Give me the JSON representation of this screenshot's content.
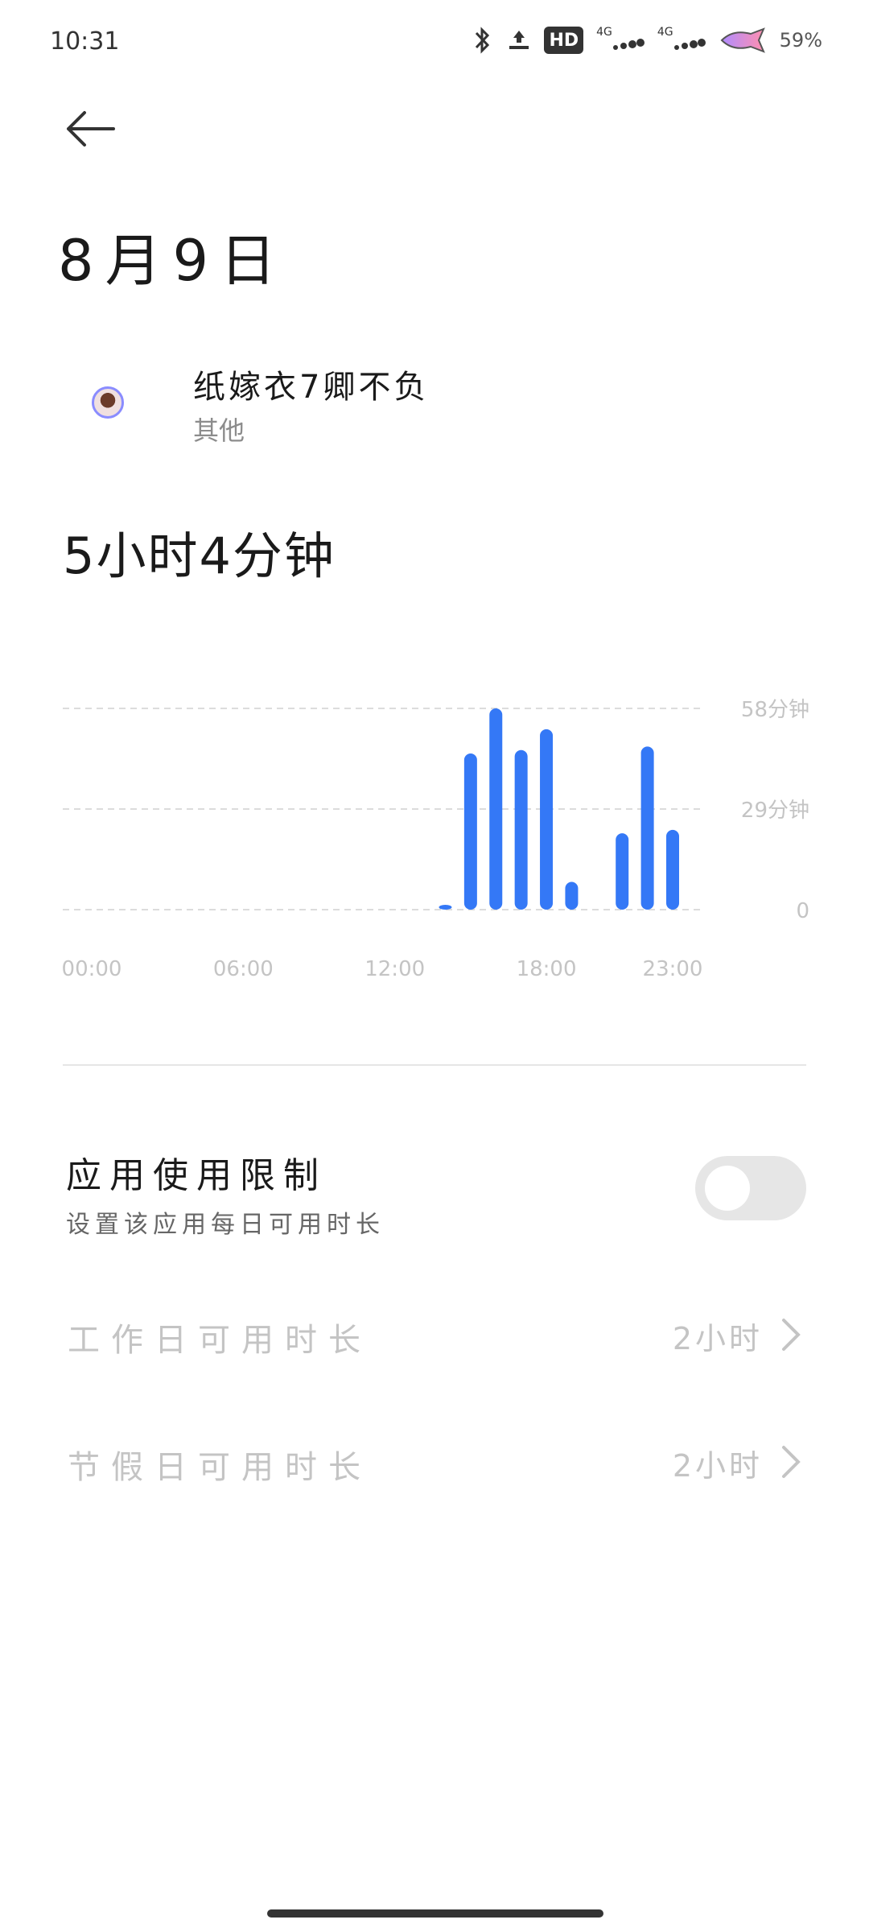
{
  "status_bar": {
    "time": "10:31",
    "hd_label": "HD",
    "network_1": "4G",
    "network_2": "4G",
    "battery": "59%",
    "icons": [
      "bluetooth-icon",
      "vpn-key-icon",
      "hd-voice-icon",
      "signal-icon",
      "signal-icon",
      "battery-icon"
    ]
  },
  "header": {
    "title": "8月9日"
  },
  "app": {
    "name": "纸嫁衣7卿不负",
    "category": "其他"
  },
  "usage": {
    "total": "5小时4分钟"
  },
  "chart_data": {
    "type": "bar",
    "title": "",
    "xlabel": "",
    "ylabel": "",
    "x_tick_labels": [
      "00:00",
      "06:00",
      "12:00",
      "18:00",
      "23:00"
    ],
    "y_tick_labels": [
      "58分钟",
      "29分钟",
      "0"
    ],
    "ylim": [
      0,
      58
    ],
    "y_ticks": [
      0,
      29,
      58
    ],
    "categories": [
      "00:00",
      "01:00",
      "02:00",
      "03:00",
      "04:00",
      "05:00",
      "06:00",
      "07:00",
      "08:00",
      "09:00",
      "10:00",
      "11:00",
      "12:00",
      "13:00",
      "14:00",
      "15:00",
      "16:00",
      "17:00",
      "18:00",
      "19:00",
      "20:00",
      "21:00",
      "22:00",
      "23:00"
    ],
    "values": [
      0,
      0,
      0,
      0,
      0,
      0,
      0,
      0,
      0,
      0,
      0,
      0,
      0,
      0,
      1,
      45,
      58,
      46,
      52,
      8,
      0,
      22,
      47,
      23
    ],
    "grid": true,
    "color": "#3478f6"
  },
  "limit": {
    "title": "应用使用限制",
    "subtitle": "设置该应用每日可用时长",
    "enabled": false
  },
  "settings": [
    {
      "label": "工作日可用时长",
      "value": "2小时"
    },
    {
      "label": "节假日可用时长",
      "value": "2小时"
    }
  ],
  "colors": {
    "accent": "#3478f6",
    "toggle_off": "#e6e6e6",
    "disabled_text": "#c4c4c4"
  }
}
